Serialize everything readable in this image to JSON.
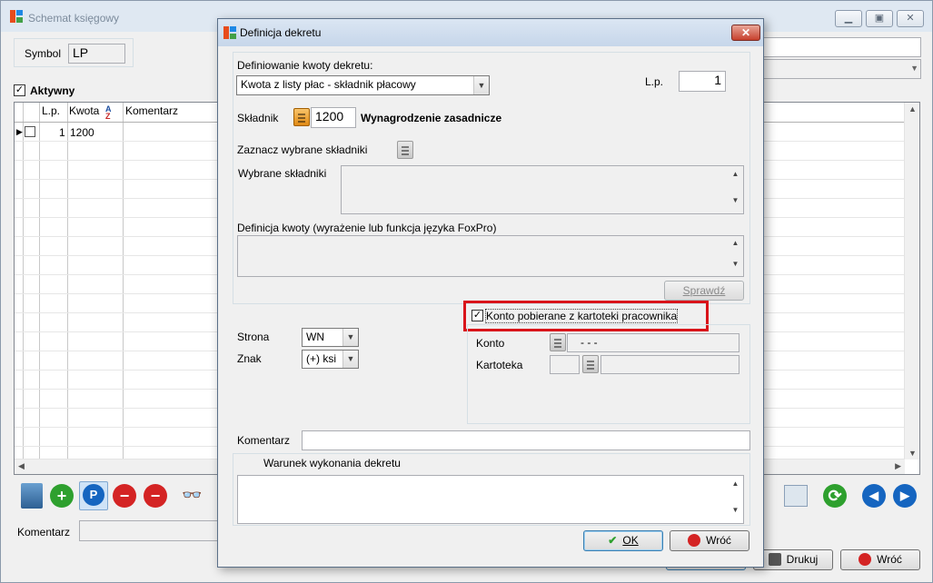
{
  "main_window": {
    "title": "Schemat księgowy",
    "symbol_label": "Symbol",
    "symbol_value": "LP",
    "active_label": "Aktywny",
    "active_checked": true,
    "grid": {
      "columns": [
        "L.p.",
        "Kwota",
        "Komentarz"
      ],
      "rows": [
        {
          "lp": "1",
          "kwota": "1200",
          "komentarz": ""
        }
      ]
    },
    "comment_label": "Komentarz",
    "comment_value": "",
    "buttons": {
      "print": "Drukuj",
      "back": "Wróć"
    }
  },
  "dialog": {
    "title": "Definicja dekretu",
    "close_label": "✕",
    "amount_definition_label": "Definiowanie kwoty dekretu:",
    "amount_definition_value": "Kwota z listy płac - składnik płacowy",
    "lp_label": "L.p.",
    "lp_value": "1",
    "component_label": "Składnik",
    "component_code": "1200",
    "component_name": "Wynagrodzenie zasadnicze",
    "select_components_label": "Zaznacz wybrane składniki",
    "selected_components_label": "Wybrane składniki",
    "amount_expression_label": "Definicja kwoty (wyrażenie lub funkcja języka  FoxPro)",
    "check_button": "Sprawdź",
    "account_from_employee_label": "Konto pobierane z kartoteki pracownika",
    "account_from_employee_checked": true,
    "side_label": "Strona",
    "side_value": "WN",
    "sign_label": "Znak",
    "sign_value": "(+) ksi",
    "account_label": "Konto",
    "account_value": "-   -   -",
    "card_label": "Kartoteka",
    "comment_label": "Komentarz",
    "condition_label": "Warunek wykonania dekretu",
    "ok_button": "OK",
    "back_button": "Wróć"
  },
  "colors": {
    "highlight_border": "#d9141a",
    "ok_border": "#3c7fb1",
    "green_icon": "#2ea02e",
    "red_icon": "#d42424",
    "blue_icon": "#1565c0"
  }
}
